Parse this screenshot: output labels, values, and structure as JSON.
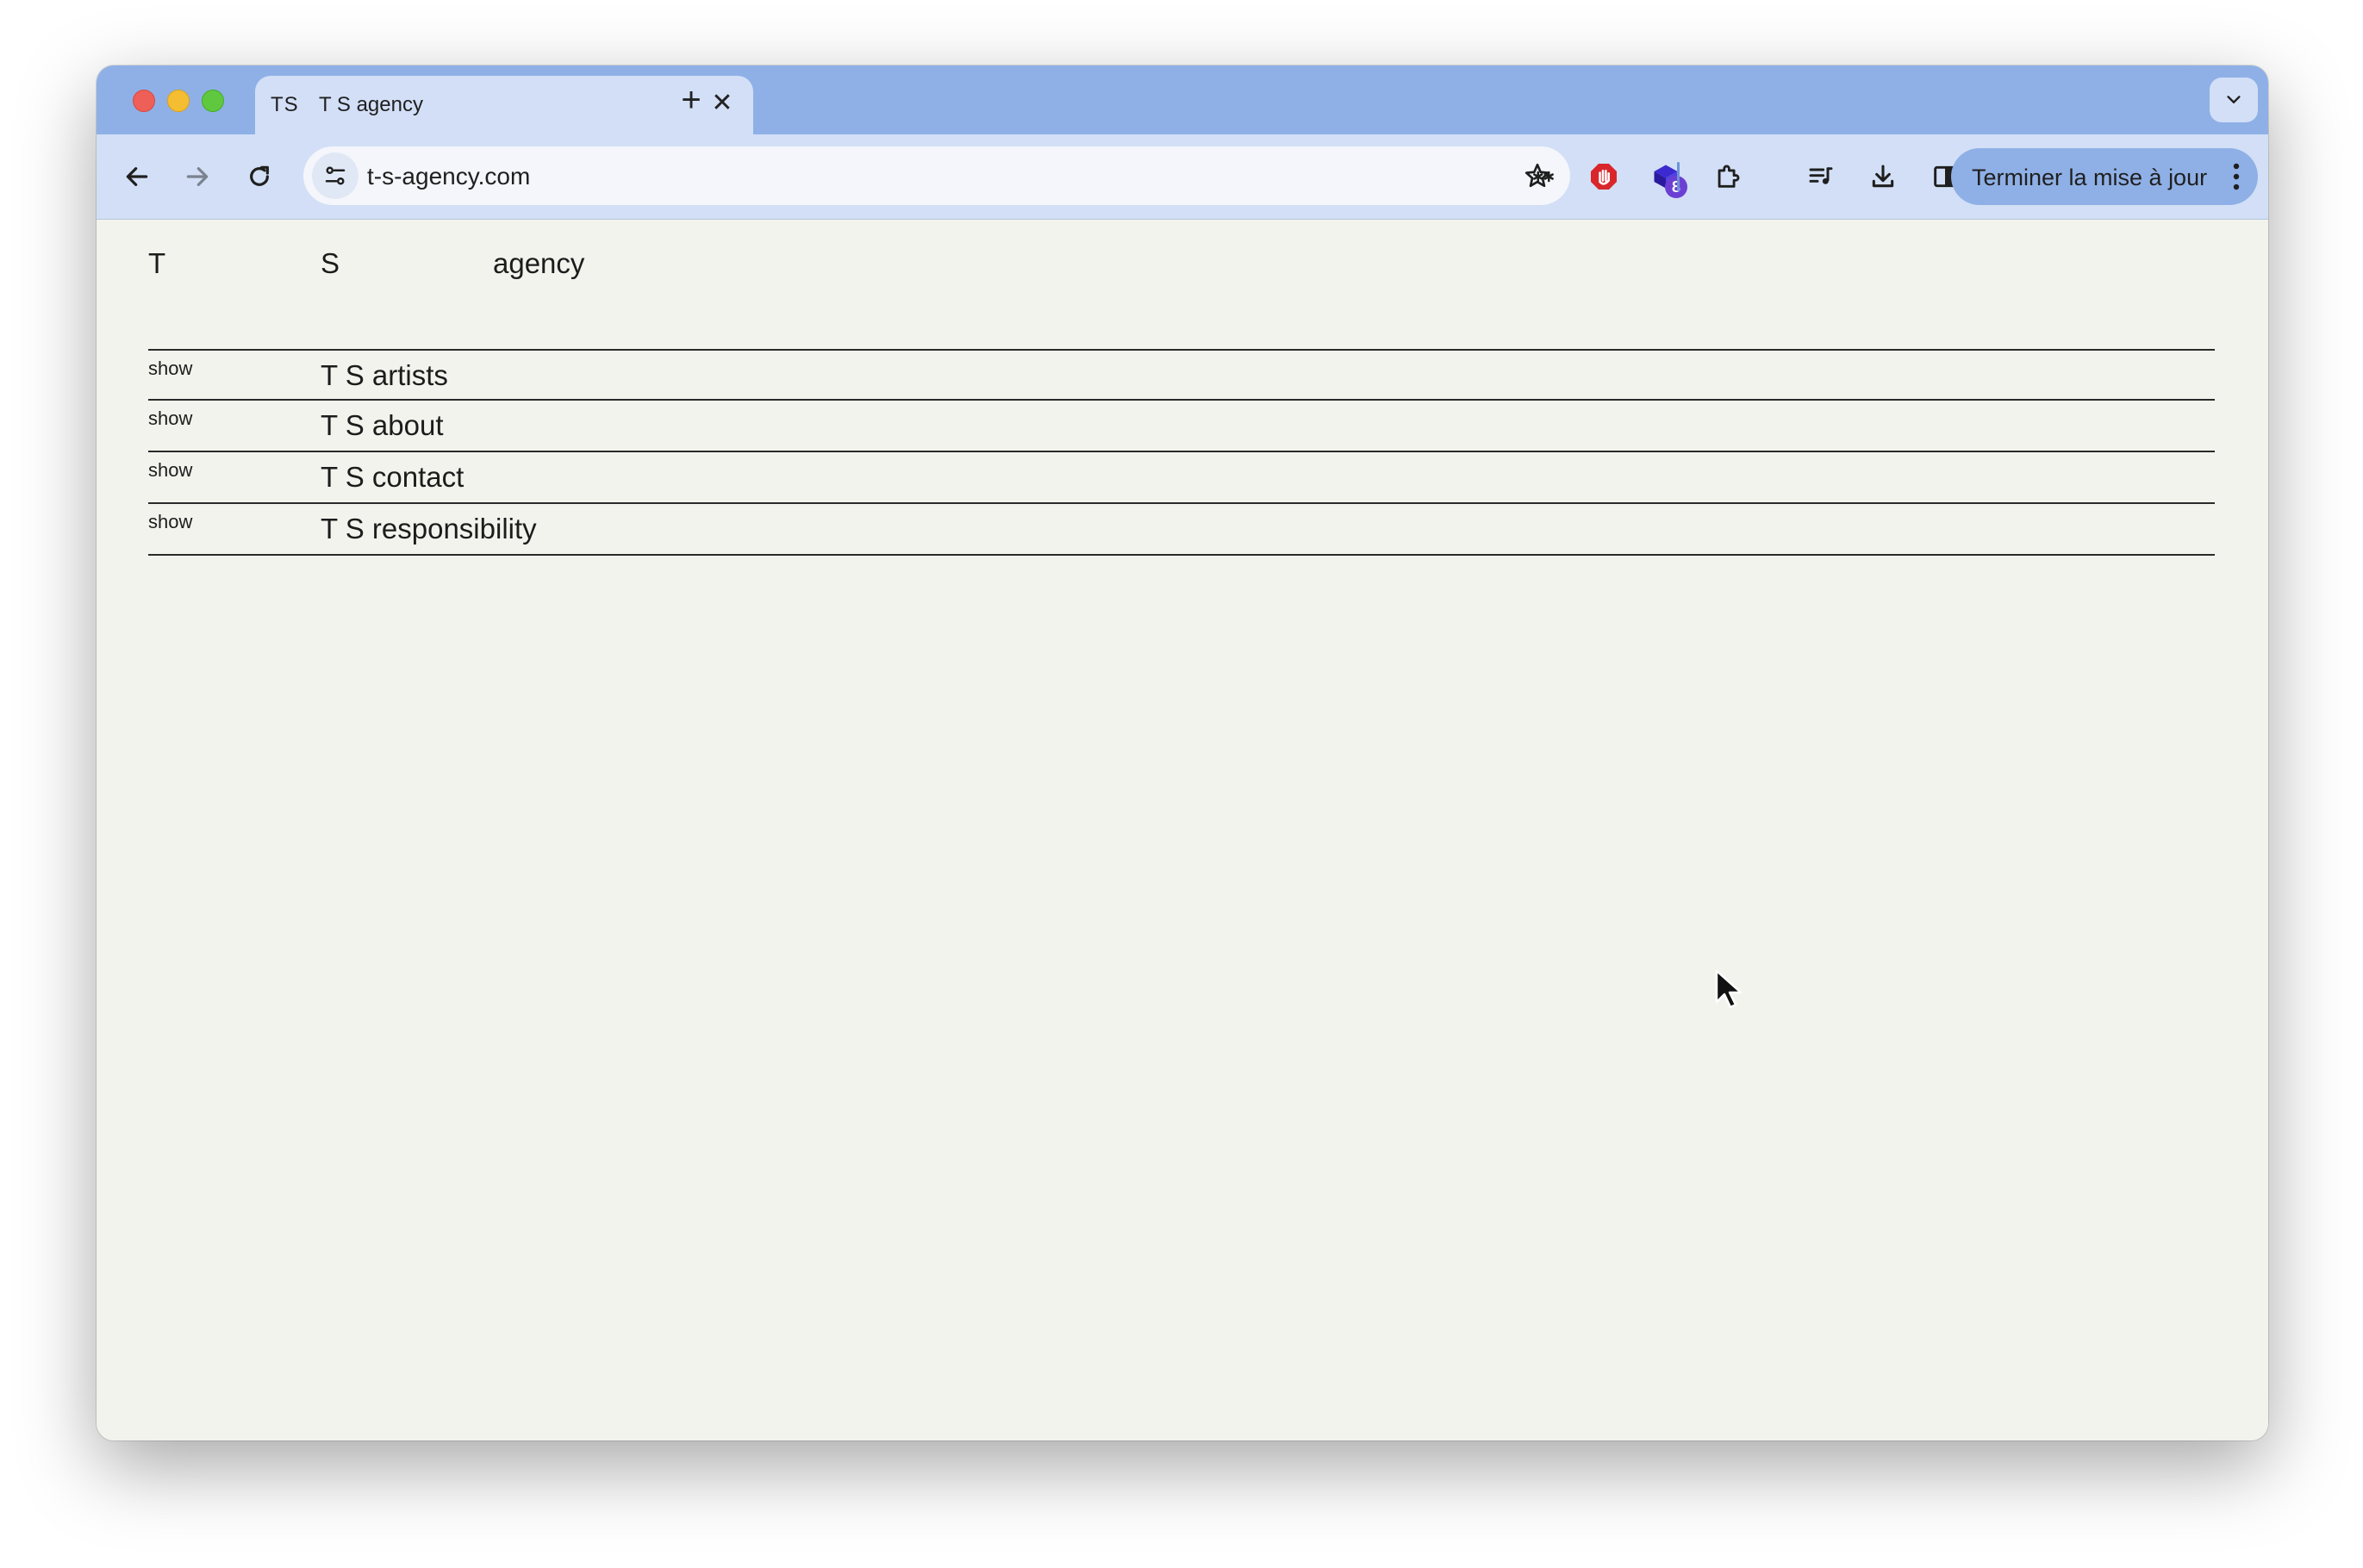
{
  "browser": {
    "tab": {
      "favicon_text": "TS",
      "title": "T S agency",
      "close_glyph": "✕"
    },
    "new_tab_glyph": "+",
    "address_bar": {
      "url": "t-s-agency.com"
    },
    "extensions": {
      "badge_count": "8"
    },
    "update_button_label": "Terminer la mise à jour"
  },
  "site": {
    "header": {
      "col1": "T",
      "col2": "S",
      "col3": "agency"
    },
    "rows": [
      {
        "toggle": "show",
        "title": "T S artists"
      },
      {
        "toggle": "show",
        "title": "T S about"
      },
      {
        "toggle": "show",
        "title": "T S contact"
      },
      {
        "toggle": "show",
        "title": "T S responsibility"
      }
    ]
  },
  "colors": {
    "tabstrip": "#8fb0e6",
    "toolbar": "#d2dff6",
    "page_background": "#f3f3ee",
    "text": "#1c1c1c"
  }
}
